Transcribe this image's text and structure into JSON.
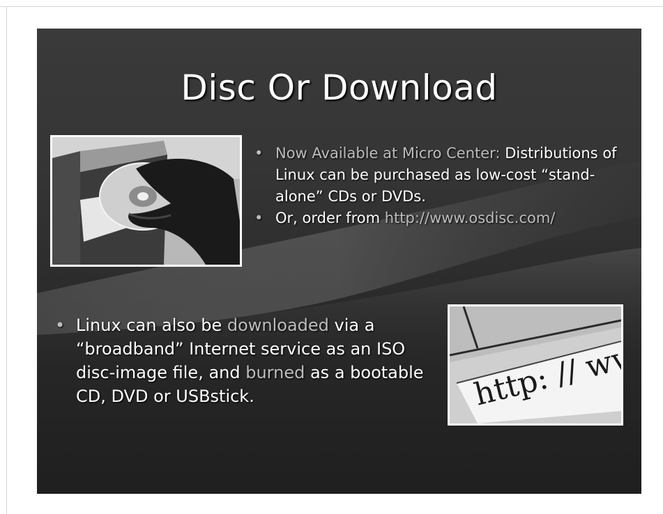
{
  "slide": {
    "title": "Disc Or Download",
    "top_bullets": [
      {
        "lead": "Now Available at Micro Center:",
        "text": "Distributions of Linux can be purchased as low-cost “stand-alone” CDs or DVDs."
      },
      {
        "lead": "Or, order from ",
        "link": "http://www.osdisc.com/"
      }
    ],
    "bottom_bullet": {
      "part1": "Linux can also be ",
      "highlight1": "downloaded",
      "part2": " via a “broadband” Internet service as an ISO disc-image file, and ",
      "highlight2": "burned",
      "part3": " as a bootable CD, DVD or USBstick."
    },
    "images": {
      "disc_photo": "hand inserting disc into computer tray (grayscale photo)",
      "url_photo_text": "http: // ww"
    }
  },
  "colors": {
    "slide_background": "#2c2c2c",
    "text": "#ffffff",
    "highlight_text": "#bdbdbd",
    "frame_border": "#ffffff"
  }
}
